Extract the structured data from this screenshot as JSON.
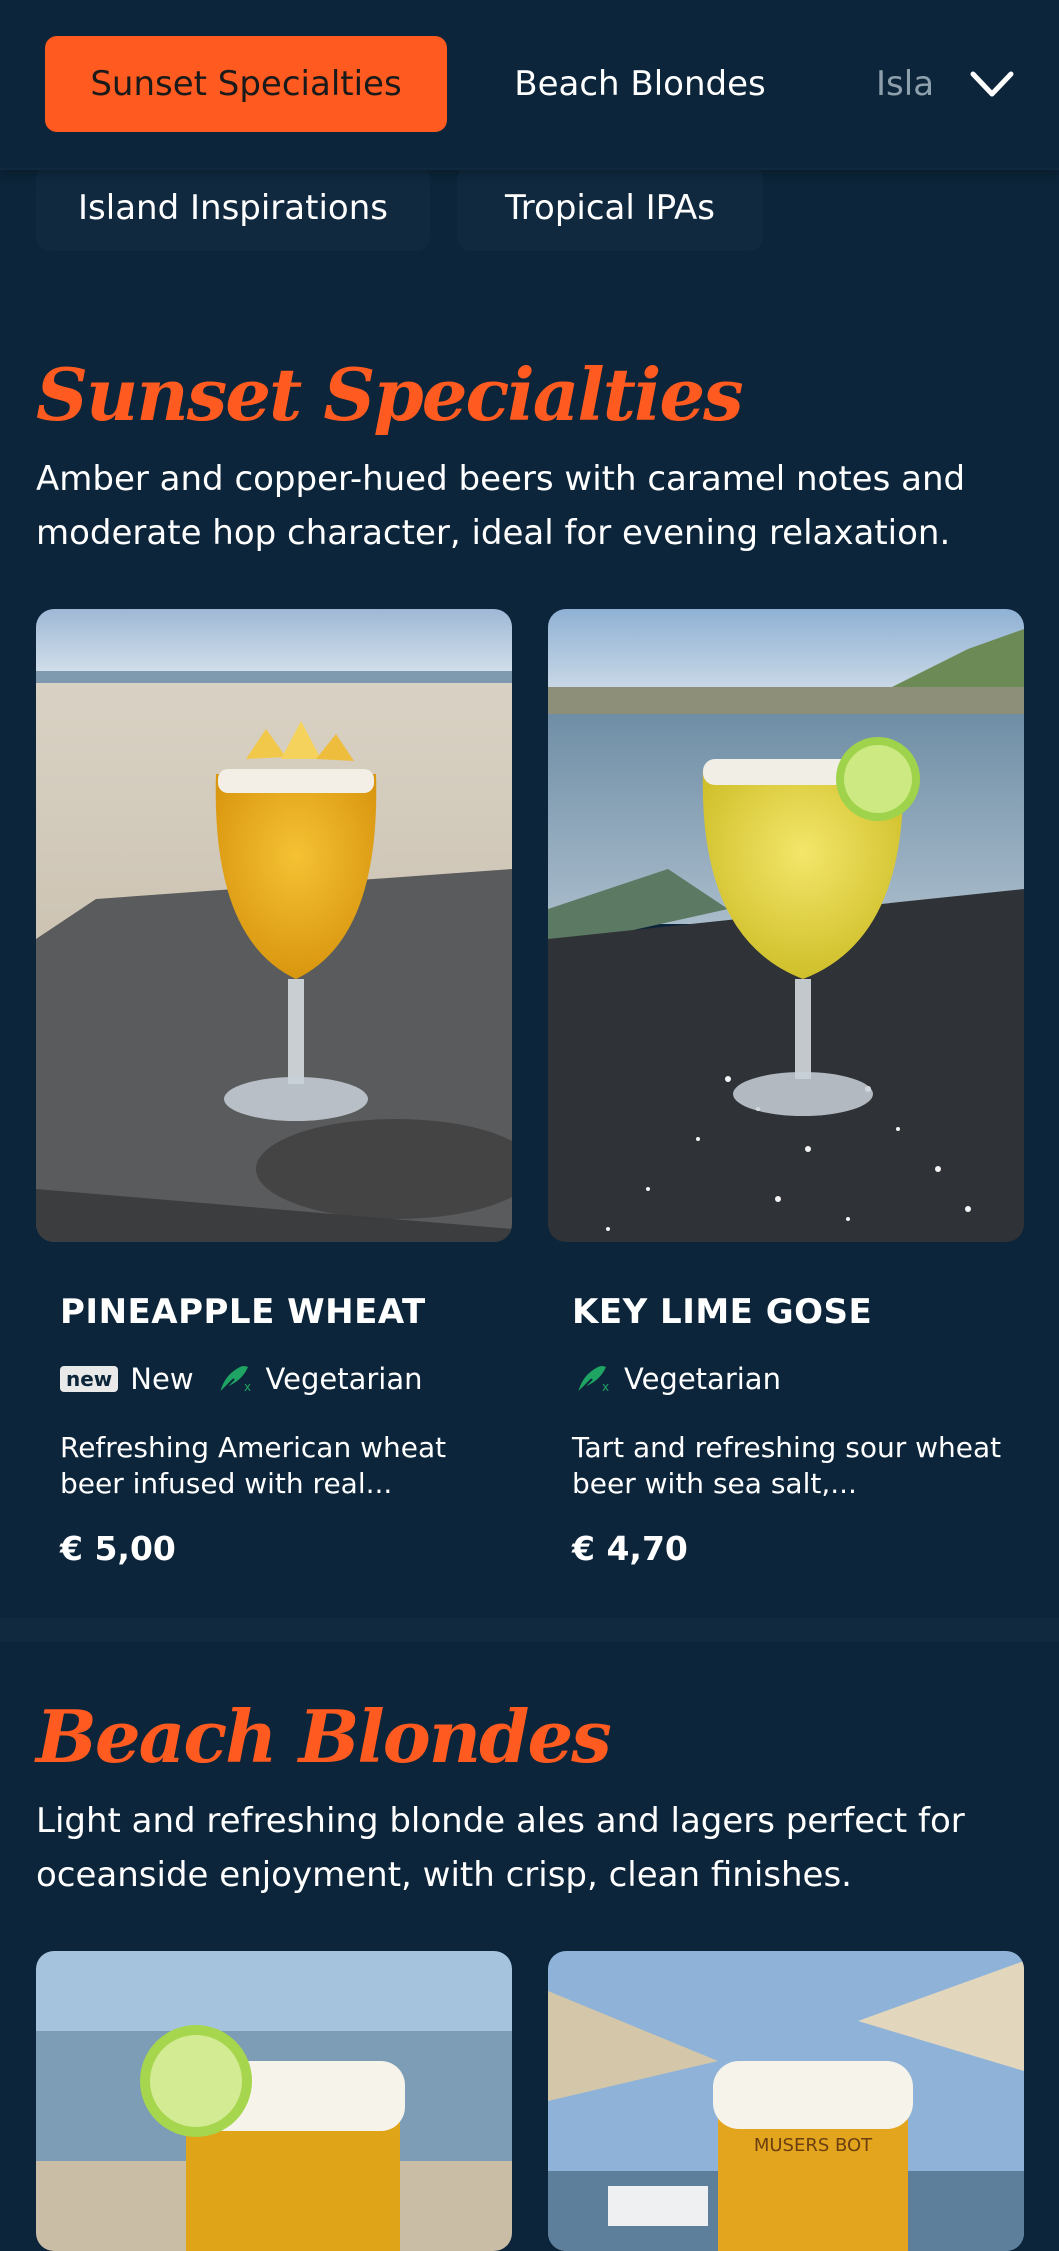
{
  "nav": {
    "tabs": [
      {
        "label": "Sunset Specialties"
      },
      {
        "label": "Beach Blondes"
      },
      {
        "label": "Island Inspirations"
      }
    ],
    "chips": [
      {
        "label": "Island Inspirations"
      },
      {
        "label": "Tropical IPAs"
      }
    ]
  },
  "sections": [
    {
      "title": "Sunset Specialties",
      "description": "Amber and copper-hued beers with caramel notes and moderate hop character, ideal for evening relaxation.",
      "items": [
        {
          "name": "PINEAPPLE WHEAT",
          "new_badge": "new",
          "new_label": "New",
          "diet_label": "Vegetarian",
          "description": "Refreshing American wheat beer infused with real...",
          "price": "€ 5,00"
        },
        {
          "name": "KEY LIME GOSE",
          "diet_label": "Vegetarian",
          "description": "Tart and refreshing sour wheat beer with sea salt,...",
          "price": "€ 4,70"
        }
      ]
    },
    {
      "title": "Beach Blondes",
      "description": "Light and refreshing blonde ales and lagers perfect for oceanside enjoyment, with crisp, clean finishes.",
      "items": [
        {
          "image_text": "MUSERS BOT"
        }
      ]
    }
  ],
  "colors": {
    "background": "#0c253a",
    "accent": "#ff5a1f",
    "vegetarian_icon": "#1fa463",
    "chip": "#10293f"
  },
  "icons": [
    "chevron-down-icon",
    "vegetarian-leaf-icon"
  ]
}
